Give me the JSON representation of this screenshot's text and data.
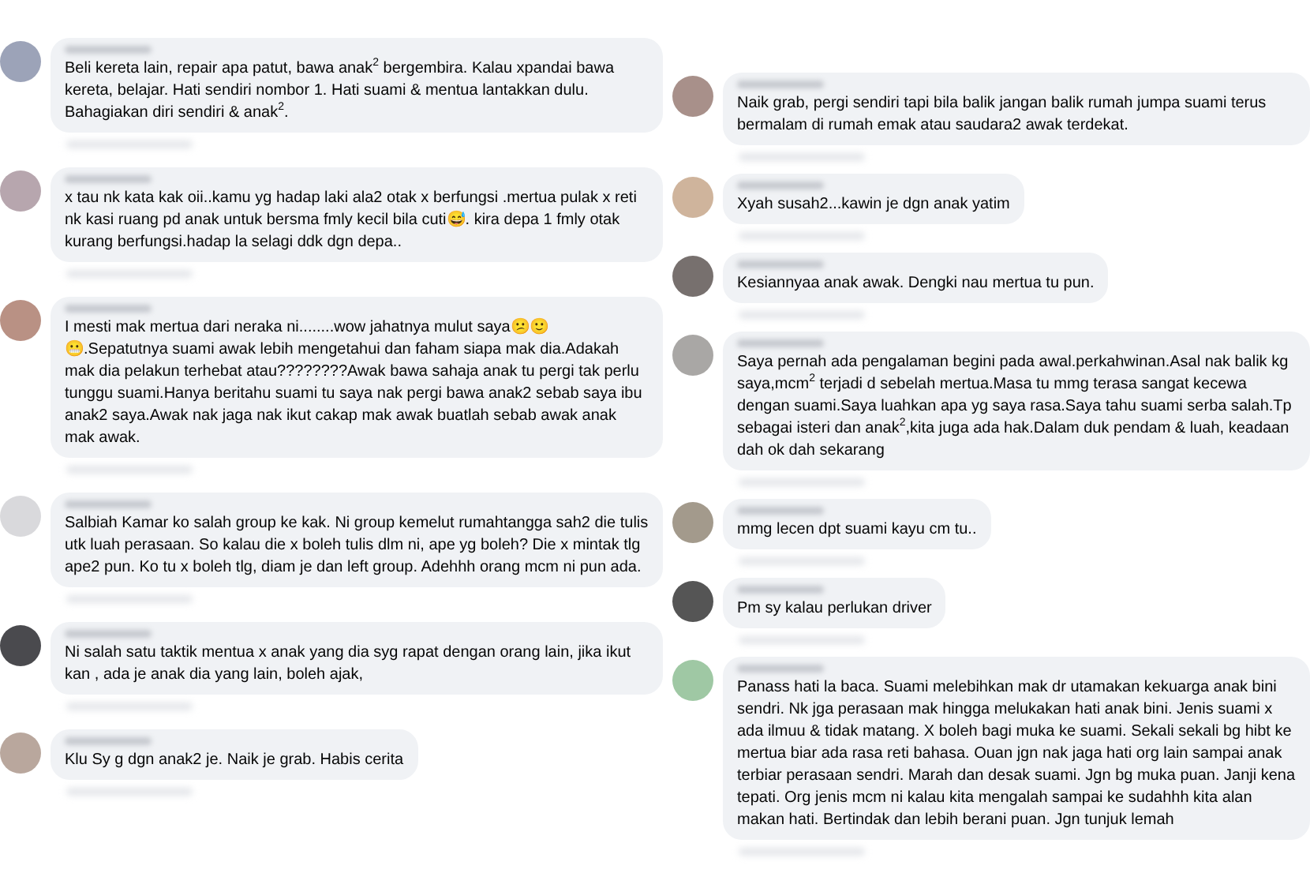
{
  "left_column": [
    {
      "color": "#9ca3b8",
      "text": "Beli kereta lain, repair apa patut, bawa anak$^{2}$ bergembira. Kalau xpandai bawa kereta, belajar. Hati sendiri nombor 1. Hati suami & mentua lantakkan dulu. Bahagiakan diri sendiri & anak$^{2}$."
    },
    {
      "color": "#b7a6ae",
      "text": "x tau nk kata kak oii..kamu yg hadap laki ala2 otak x berfungsi .mertua pulak x reti nk kasi ruang pd anak untuk bersma fmly kecil bila cuti😅. kira depa 1 fmly otak kurang berfungsi.hadap la selagi ddk dgn depa.."
    },
    {
      "color": "#b99184",
      "text": "I mesti mak mertua dari neraka ni........wow jahatnya mulut saya😕🙂😬.Sepatutnya suami awak lebih mengetahui dan faham siapa mak dia.Adakah mak dia pelakun terhebat atau????????Awak bawa sahaja anak tu pergi tak perlu tunggu suami.Hanya beritahu suami tu saya nak pergi bawa anak2 sebab saya ibu anak2 saya.Awak nak jaga nak ikut cakap mak awak buatlah sebab awak anak mak awak."
    },
    {
      "color": "#d9d9dc",
      "text": "Salbiah Kamar ko salah group ke kak. Ni group kemelut rumahtangga sah2 die tulis utk luah perasaan. So kalau die x boleh tulis dlm ni, ape yg boleh? Die x mintak tlg ape2 pun. Ko tu x boleh tlg, diam je dan left group. Adehhh orang mcm ni pun ada."
    },
    {
      "color": "#4a4a4e",
      "text": "Ni salah satu taktik mentua x anak yang dia syg rapat dengan orang lain, jika ikut kan , ada je anak dia yang lain, boleh ajak,"
    },
    {
      "color": "#b9a79d",
      "text": "Klu Sy g dgn anak2 je. Naik je grab. Habis cerita"
    }
  ],
  "right_column": [
    {
      "color": "#a8908a",
      "text": "Naik grab, pergi sendiri tapi bila balik jangan balik rumah jumpa suami terus bermalam di rumah emak atau saudara2 awak terdekat."
    },
    {
      "color": "#cfb49c",
      "text": "Xyah susah2...kawin je dgn anak yatim"
    },
    {
      "color": "#77706e",
      "text": "Kesiannyaa anak awak. Dengki nau mertua tu pun."
    },
    {
      "color": "#a9a7a5",
      "text": "Saya pernah ada pengalaman begini pada awal.perkahwinan.Asal nak balik kg saya,mcm$^{2}$ terjadi d sebelah mertua.Masa tu mmg terasa sangat kecewa dengan suami.Saya luahkan apa yg saya rasa.Saya tahu suami serba salah.Tp sebagai isteri dan anak$^{2}$,kita juga ada hak.Dalam duk pendam & luah, keadaan dah ok dah sekarang"
    },
    {
      "color": "#a39a8c",
      "text": "mmg lecen dpt suami kayu cm tu.."
    },
    {
      "color": "#555555",
      "text": "Pm sy kalau perlukan driver"
    },
    {
      "color": "#9fc8a4",
      "text": "Panass hati la baca. Suami melebihkan mak dr utamakan kekuarga anak bini sendri. Nk jga perasaan mak hingga melukakan hati anak bini. Jenis suami x ada ilmuu & tidak matang. X boleh bagi muka ke suami. Sekali sekali bg hibt ke mertua biar ada rasa reti bahasa. Ouan jgn nak jaga hati org lain sampai anak terbiar perasaan sendri. Marah dan desak suami. Jgn bg muka puan. Janji kena tepati. Org jenis mcm ni kalau kita mengalah sampai ke sudahhh kita alan makan hati. Bertindak dan lebih berani puan. Jgn tunjuk lemah"
    }
  ]
}
